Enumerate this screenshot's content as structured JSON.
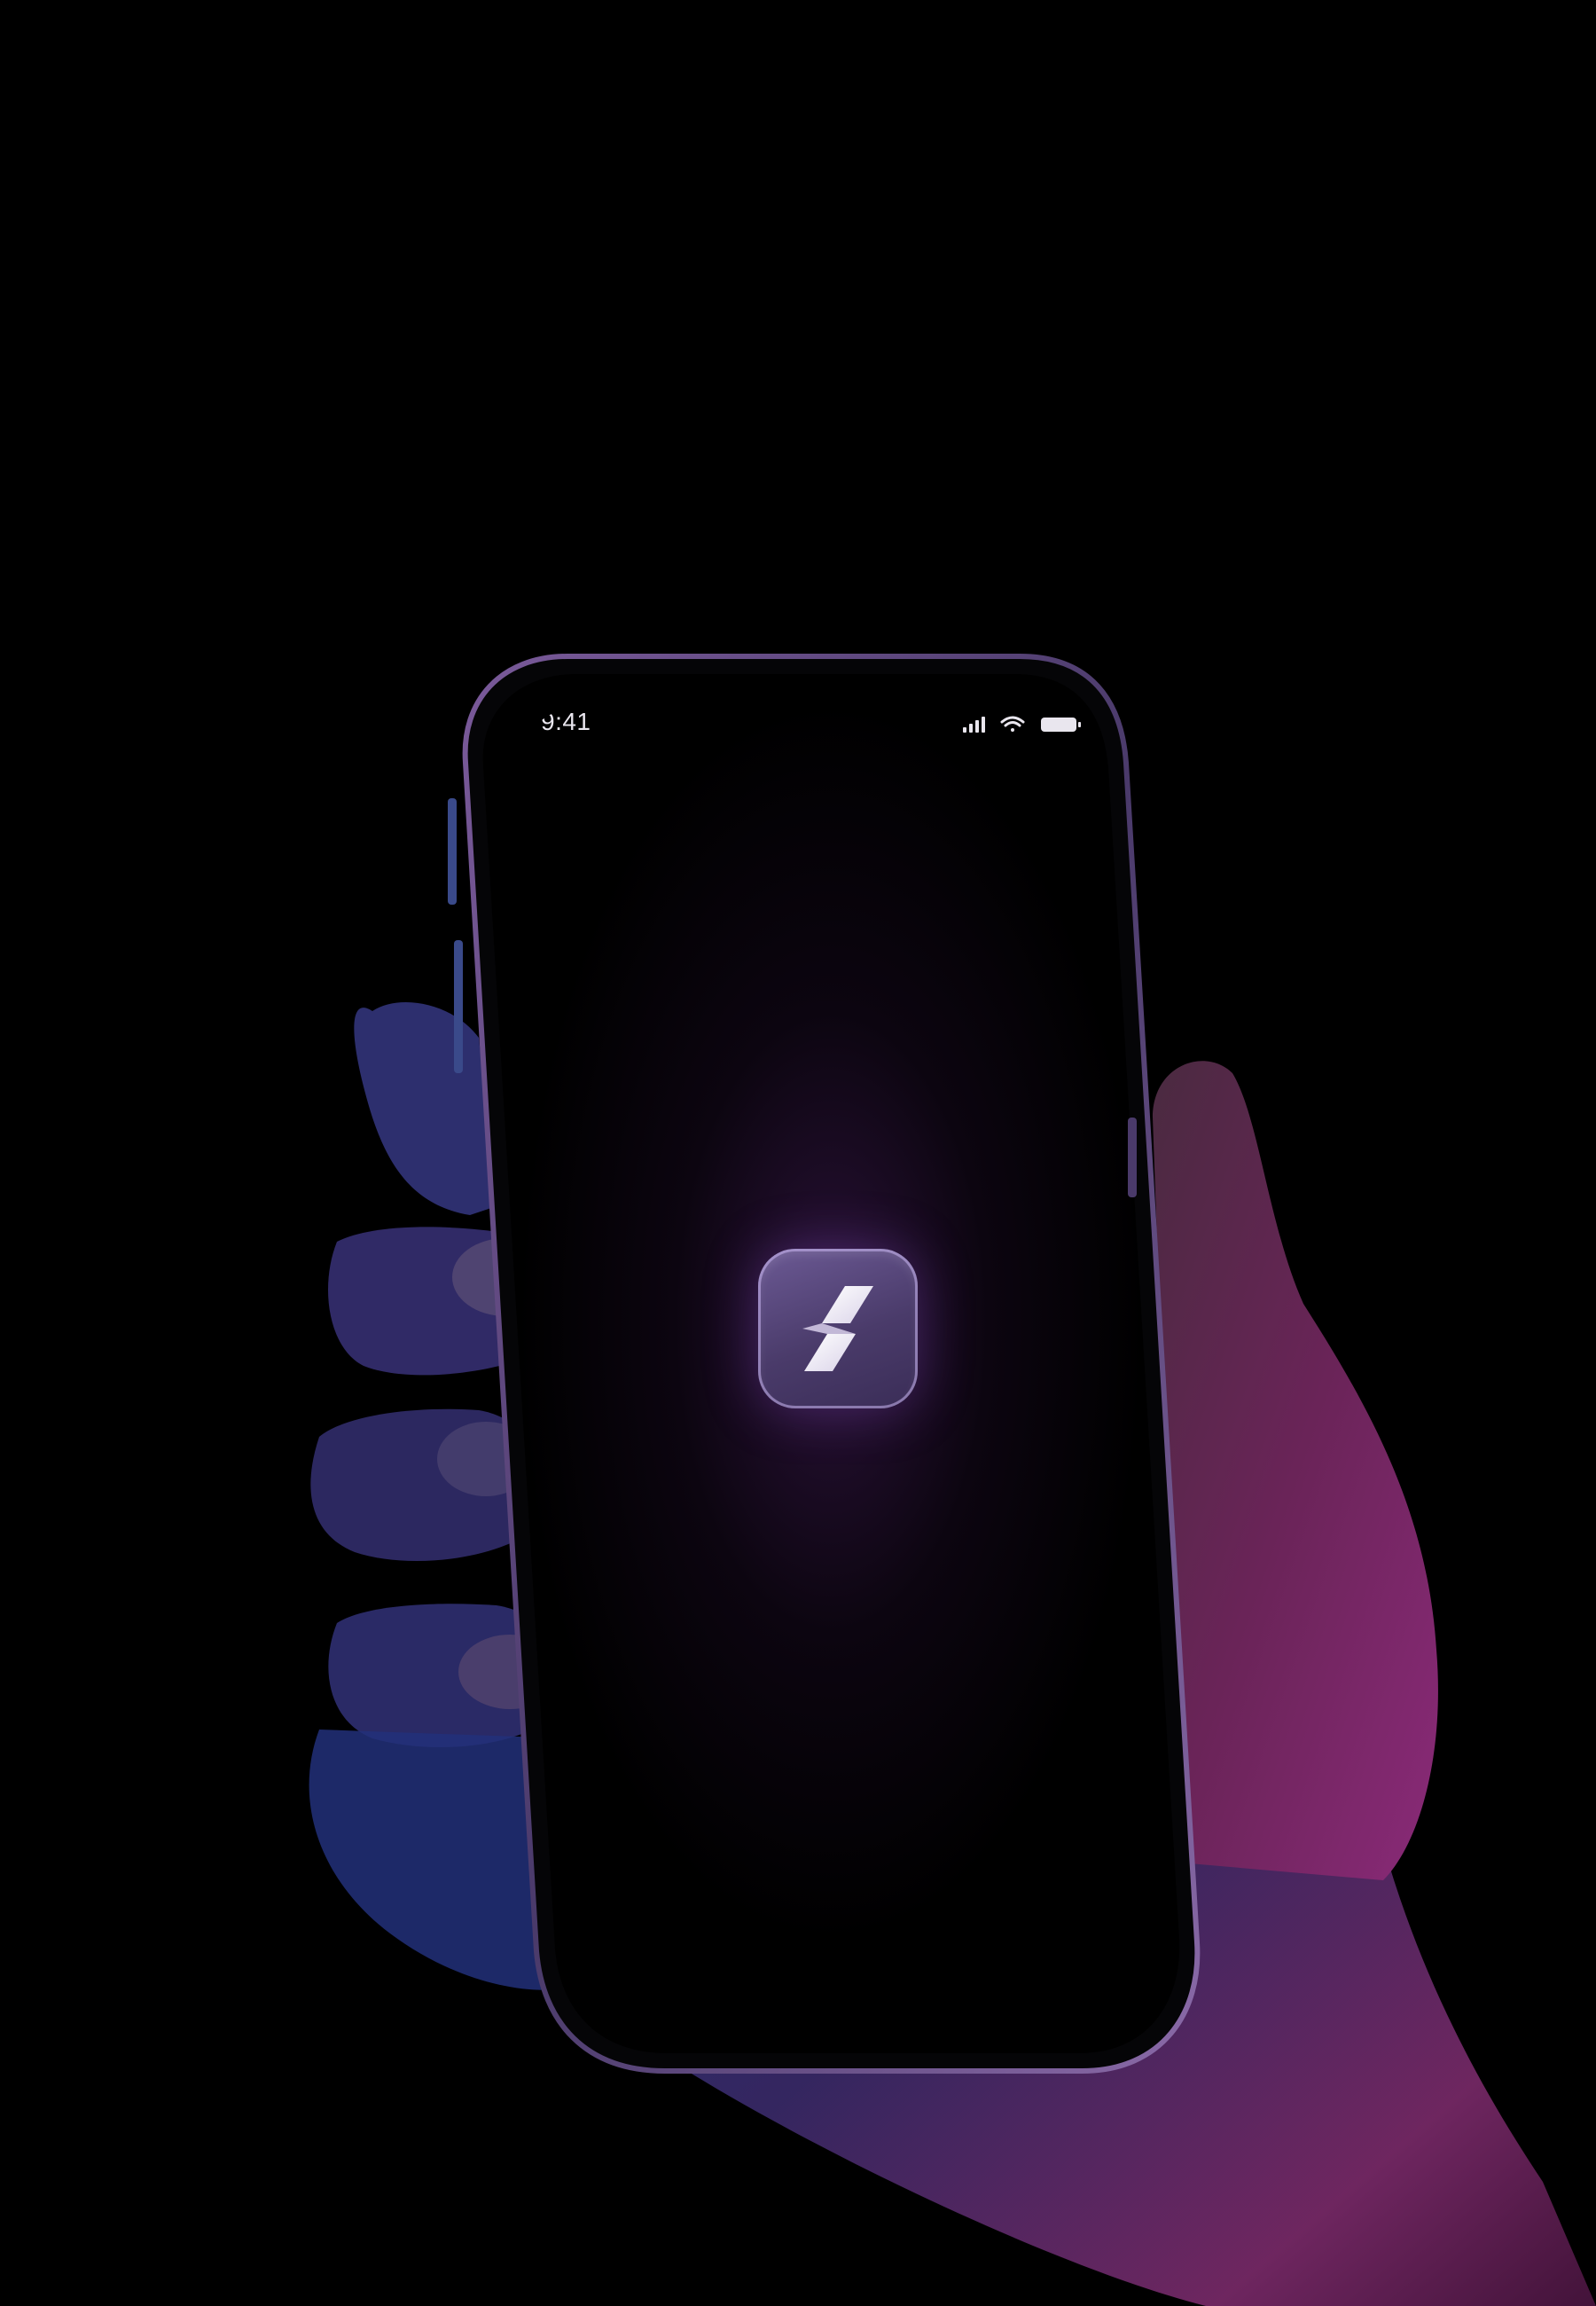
{
  "status_bar": {
    "time": "9:41",
    "icons": [
      "cellular-signal-icon",
      "wifi-icon",
      "battery-icon"
    ]
  },
  "app": {
    "icon": "lightning-bolt-icon",
    "accent_color": "#5b4a82",
    "glow_color": "#8a4fd0"
  }
}
